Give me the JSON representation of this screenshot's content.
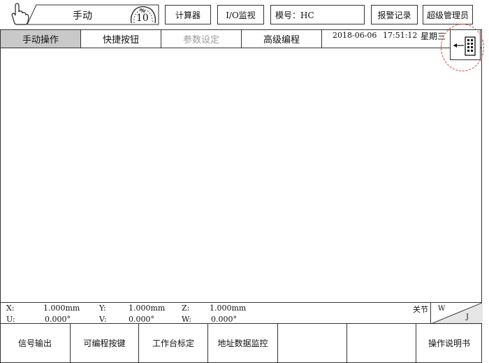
{
  "header": {
    "mode_label": "手动",
    "percent_symbol": "%",
    "percent_value": "10",
    "buttons": {
      "calculator": "计算器",
      "io_monitor": "I/O监视",
      "model": "模号：HC",
      "alarm_log": "报警记录",
      "admin": "超级管理员"
    }
  },
  "tabs": [
    {
      "label": "手动操作",
      "state": "active"
    },
    {
      "label": "快捷按钮",
      "state": "normal"
    },
    {
      "label": "参数设定",
      "state": "disabled"
    },
    {
      "label": "高级编程",
      "state": "normal"
    }
  ],
  "status": {
    "date": "2018-06-06",
    "time": "17:51:12",
    "weekday": "星期三"
  },
  "coordinates": {
    "x_label": "X:",
    "x_value": "1.000mm",
    "y_label": "Y:",
    "y_value": "1.000mm",
    "z_label": "Z:",
    "z_value": "1.000mm",
    "u_label": "U:",
    "u_value": "0.000°",
    "v_label": "V:",
    "v_value": "0.000°",
    "w_label": "W:",
    "w_value": "0.000°",
    "joint_label": "关节",
    "w_corner": "W",
    "j_corner": "J"
  },
  "bottom_buttons": [
    "信号输出",
    "可编程按键",
    "工作台标定",
    "地址数据监控",
    "",
    "",
    "操作说明书"
  ],
  "colors": {
    "active_tab": "#c9c9c9",
    "disabled_text": "#9a9a9a",
    "highlight_circle": "#e03030"
  }
}
